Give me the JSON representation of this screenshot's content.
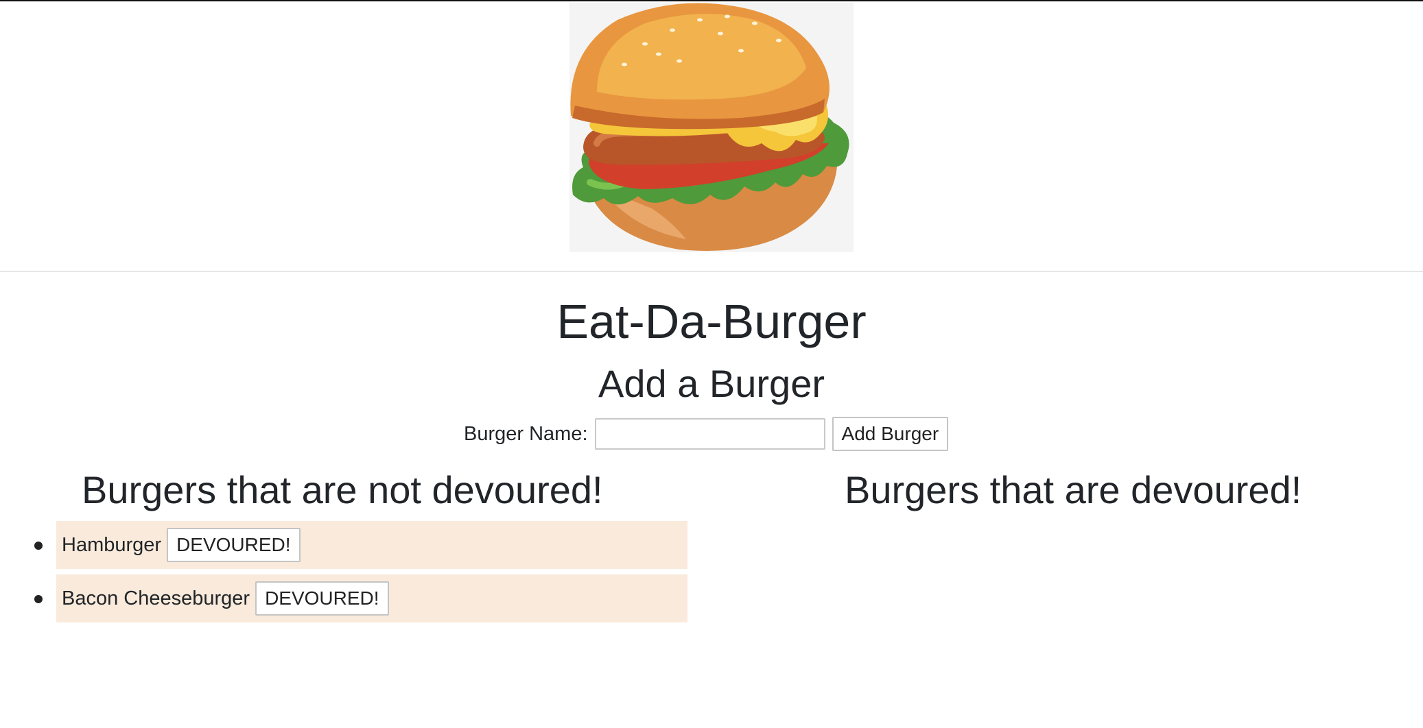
{
  "header": {
    "logo_icon": "burger-logo-icon"
  },
  "page": {
    "title": "Eat-Da-Burger",
    "add_heading": "Add a Burger"
  },
  "form": {
    "label": "Burger Name:",
    "input_value": "",
    "input_placeholder": "",
    "submit_label": "Add Burger"
  },
  "columns": {
    "not_devoured_heading": "Burgers that are not devoured!",
    "devoured_heading": "Burgers that are devoured!"
  },
  "not_devoured": [
    {
      "name": "Hamburger",
      "button_label": "DEVOURED!"
    },
    {
      "name": "Bacon Cheeseburger",
      "button_label": "DEVOURED!"
    }
  ],
  "devoured": [],
  "colors": {
    "item_background": "#f9eadb",
    "text": "#212529"
  }
}
